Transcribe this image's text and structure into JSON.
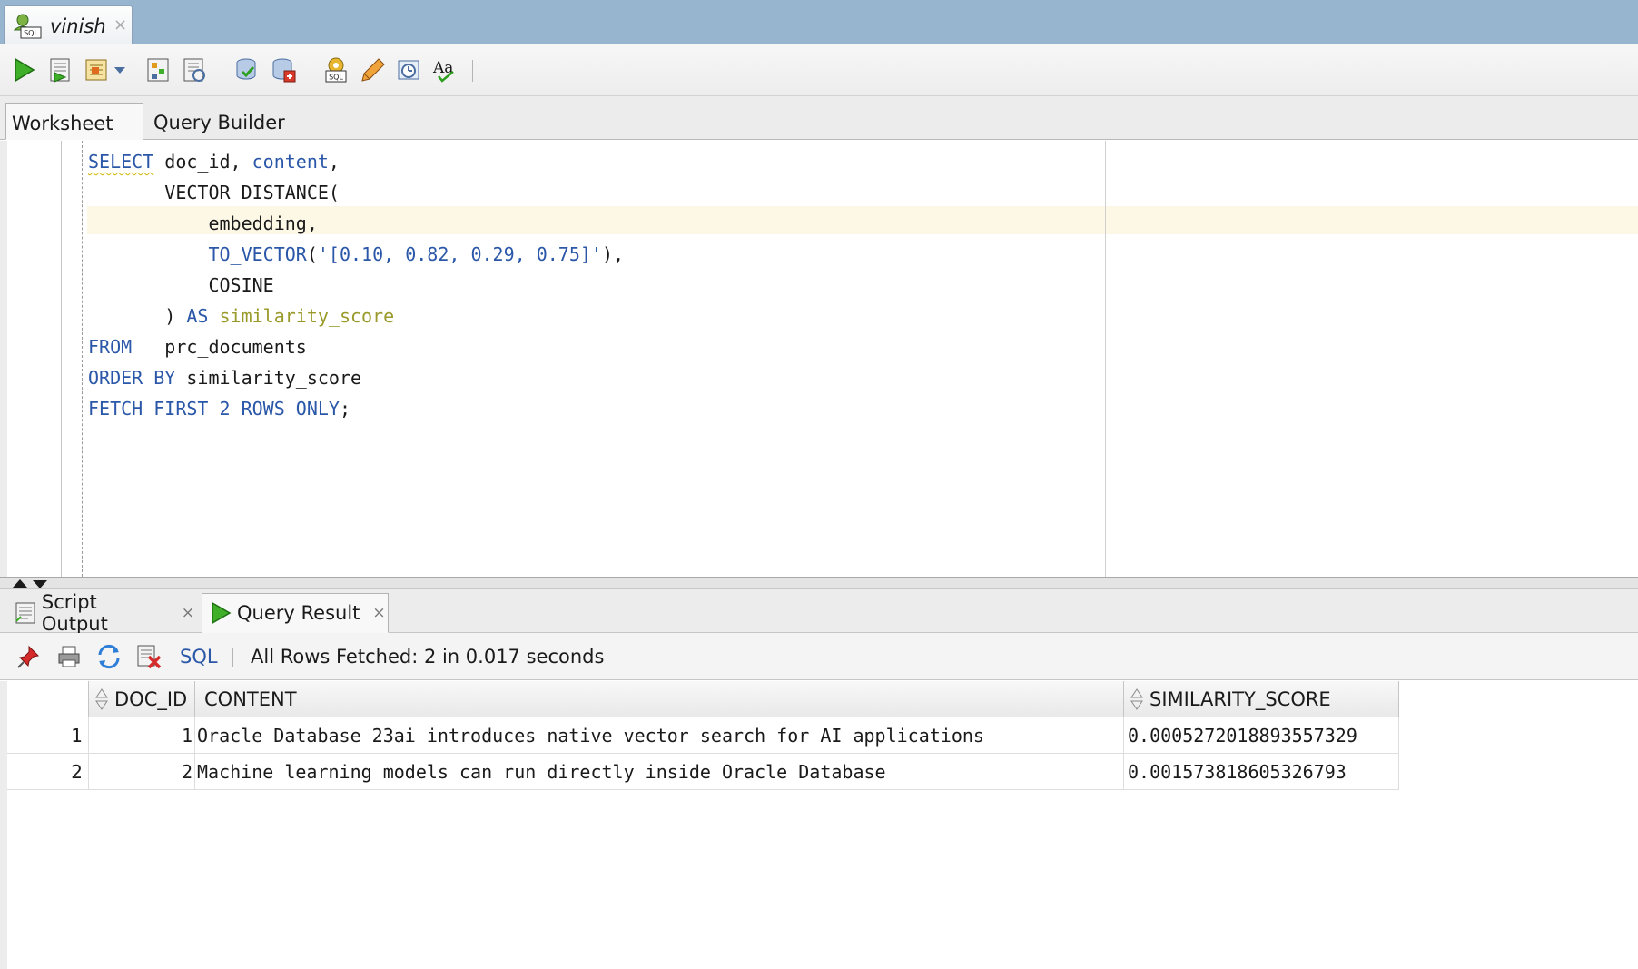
{
  "doc_tab": {
    "label": "vinish",
    "close": "×",
    "icon": "sql-connection-icon"
  },
  "toolbar": {
    "buttons": [
      "run-statement-icon",
      "run-script-icon",
      "autotrace-icon",
      "dropdown-arrow-icon",
      "commit-icon",
      "rollback-icon",
      "explain-plan-icon",
      "tuning-icon",
      "sql-history-icon",
      "clear-icon",
      "sql-tuning-advisor-icon",
      "format-icon"
    ]
  },
  "worksheet_tabs": {
    "active": "Worksheet",
    "inactive": "Query Builder"
  },
  "editor": {
    "lines": [
      [
        [
          "kw",
          "SELECT"
        ],
        [
          "t",
          " doc_id, "
        ],
        [
          "kw",
          "content"
        ],
        [
          "t",
          ","
        ]
      ],
      [
        [
          "t",
          "       VECTOR_DISTANCE("
        ]
      ],
      [
        [
          "t",
          "           embedding,"
        ]
      ],
      [
        [
          "t",
          "           "
        ],
        [
          "kw",
          "TO_VECTOR"
        ],
        [
          "t",
          "("
        ],
        [
          "str",
          "'[0.10, 0.82, 0.29, 0.75]'"
        ],
        [
          "t",
          "),"
        ]
      ],
      [
        [
          "t",
          "           COSINE"
        ]
      ],
      [
        [
          "t",
          "       ) "
        ],
        [
          "kw",
          "AS"
        ],
        [
          "t",
          " "
        ],
        [
          "alias",
          "similarity_score"
        ]
      ],
      [
        [
          "kw",
          "FROM"
        ],
        [
          "t",
          "   prc_documents"
        ]
      ],
      [
        [
          "kw",
          "ORDER BY"
        ],
        [
          "t",
          " similarity_score"
        ]
      ],
      [
        [
          "kw",
          "FETCH FIRST"
        ],
        [
          "t",
          " "
        ],
        [
          "num",
          "2"
        ],
        [
          "t",
          " "
        ],
        [
          "kw",
          "ROWS ONLY"
        ],
        [
          "t",
          ";"
        ]
      ]
    ]
  },
  "result_tabs": [
    {
      "label": "Script Output",
      "close": "×",
      "icon": "script-output-icon"
    },
    {
      "label": "Query Result",
      "close": "×",
      "icon": "run-icon"
    }
  ],
  "result_toolbar": {
    "sql_link": "SQL",
    "status": "All Rows Fetched: 2 in 0.017 seconds",
    "icons": [
      "pin-icon",
      "print-icon",
      "refresh-icon",
      "delete-icon"
    ]
  },
  "grid": {
    "columns": [
      "DOC_ID",
      "CONTENT",
      "SIMILARITY_SCORE"
    ],
    "rows": [
      {
        "num": "1",
        "doc_id": "1",
        "content": "Oracle Database 23ai introduces native vector search for AI applications",
        "score": "0.0005272018893557329"
      },
      {
        "num": "2",
        "doc_id": "2",
        "content": "Machine learning models can run directly inside Oracle Database",
        "score": "0.001573818605326793"
      }
    ]
  },
  "colors": {
    "tab_strip": "#98b5d0",
    "keyword": "#2a57a8",
    "alias": "#999a2a",
    "current_line": "#fdf7e6"
  }
}
